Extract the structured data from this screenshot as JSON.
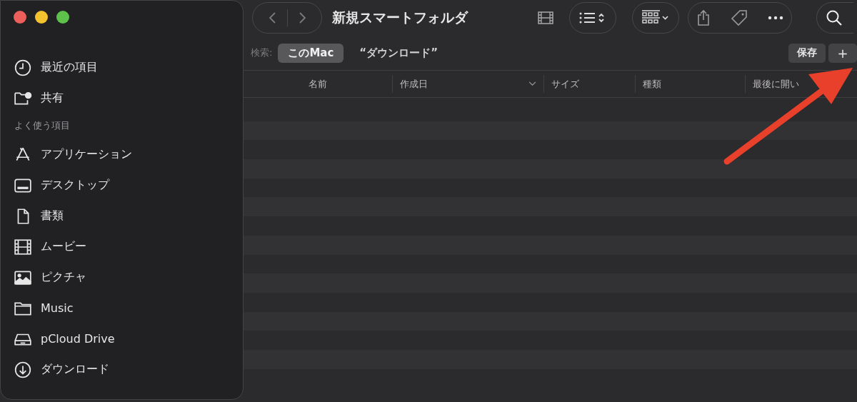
{
  "window": {
    "title": "新規スマートフォルダ"
  },
  "sidebar": {
    "sections": [
      {
        "items": [
          {
            "kind": "clock",
            "label": "最近の項目"
          },
          {
            "kind": "shared",
            "label": "共有"
          }
        ]
      },
      {
        "title": "よく使う項目",
        "items": [
          {
            "kind": "apps",
            "label": "アプリケーション"
          },
          {
            "kind": "desktop",
            "label": "デスクトップ"
          },
          {
            "kind": "document",
            "label": "書類"
          },
          {
            "kind": "film",
            "label": "ムービー"
          },
          {
            "kind": "photo",
            "label": "ピクチャ"
          },
          {
            "kind": "folder",
            "label": "Music"
          },
          {
            "kind": "drive",
            "label": "pCloud Drive"
          },
          {
            "kind": "download",
            "label": "ダウンロード"
          }
        ]
      }
    ]
  },
  "search": {
    "label": "検索:",
    "scopes": [
      {
        "label": "このMac",
        "selected": true
      },
      {
        "label": "“ダウンロード”",
        "selected": false
      }
    ],
    "buttons": [
      "保存",
      "+"
    ]
  },
  "table": {
    "columns": [
      {
        "label": "名前",
        "sorted": false
      },
      {
        "label": "作成日",
        "sorted": true
      },
      {
        "label": "サイズ",
        "sorted": false
      },
      {
        "label": "種類",
        "sorted": false
      },
      {
        "label": "最後に開い",
        "sorted": false
      }
    ]
  }
}
